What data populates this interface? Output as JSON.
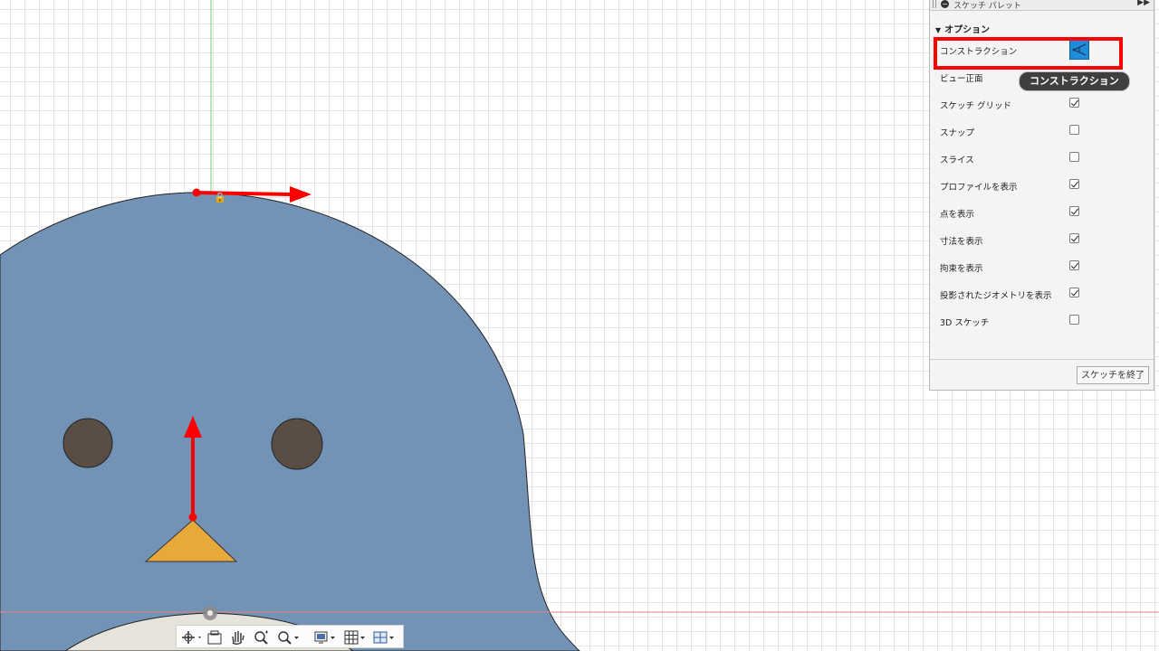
{
  "palette": {
    "title": "スケッチ パレット",
    "expand_icon": "double-right-arrow-icon",
    "section": "オプション",
    "rows": [
      {
        "label": "コンストラクション",
        "type": "button",
        "active": true
      },
      {
        "label": "ビュー正面",
        "type": "none"
      },
      {
        "label": "スケッチ グリッド",
        "checked": true
      },
      {
        "label": "スナップ",
        "checked": false
      },
      {
        "label": "スライス",
        "checked": false
      },
      {
        "label": "プロファイルを表示",
        "checked": true
      },
      {
        "label": "点を表示",
        "checked": true
      },
      {
        "label": "寸法を表示",
        "checked": true
      },
      {
        "label": "拘束を表示",
        "checked": true
      },
      {
        "label": "投影されたジオメトリを表示",
        "checked": true
      },
      {
        "label": "3D スケッチ",
        "checked": false
      }
    ],
    "finish_button": "スケッチを終了"
  },
  "tooltip": "コンストラクション",
  "colors": {
    "body": "#7393b6",
    "eye": "#5a4e44",
    "beak": "#e6a93a",
    "belly": "#e6e4da",
    "x_axis_arrow": "#ff0000",
    "highlight": "#ff0000",
    "construction_active": "#1e8cdb"
  },
  "navbar": {
    "icons": [
      "orbit-icon",
      "look-at-icon",
      "pan-hand-icon",
      "zoom-icon",
      "zoom-window-icon",
      "display-settings-icon",
      "grid-settings-icon",
      "viewports-icon"
    ]
  }
}
